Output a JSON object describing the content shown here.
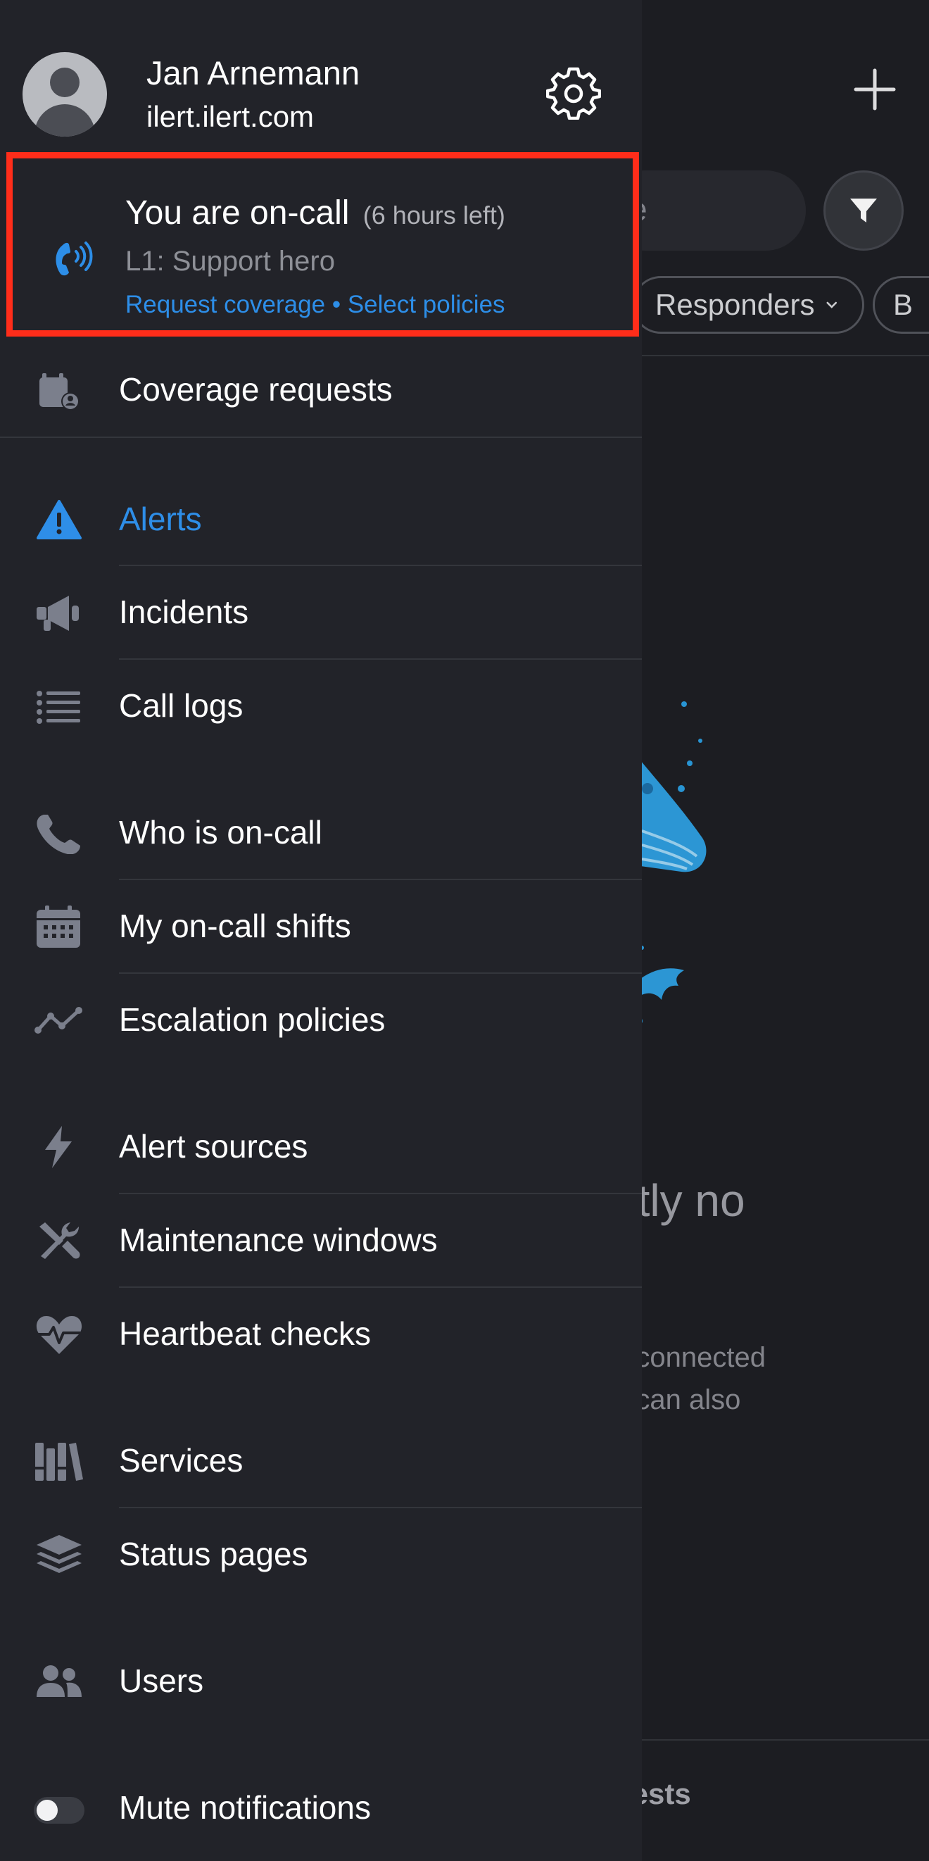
{
  "background": {
    "search_visible_text": "e",
    "chips": [
      "Responders",
      "B"
    ],
    "empty_title_fragment": "ntly no",
    "empty_text_fragment_1": "e connected",
    "empty_text_fragment_2": "n can also",
    "bottom_fragment": "uests"
  },
  "drawer": {
    "user": {
      "name": "Jan Arnemann",
      "domain": "ilert.ilert.com"
    },
    "oncall": {
      "title": "You are on-call",
      "time_left": "(6 hours left)",
      "role": "L1: Support hero",
      "link_request": "Request coverage",
      "separator": "•",
      "link_policies": "Select policies"
    },
    "items": [
      {
        "label": "Coverage requests",
        "icon": "calendar-user-icon"
      },
      {
        "label": "Alerts",
        "icon": "warning-triangle-icon",
        "active": true
      },
      {
        "label": "Incidents",
        "icon": "megaphone-icon"
      },
      {
        "label": "Call logs",
        "icon": "list-icon"
      },
      {
        "label": "Who is on-call",
        "icon": "phone-icon"
      },
      {
        "label": "My on-call shifts",
        "icon": "calendar-icon"
      },
      {
        "label": "Escalation policies",
        "icon": "chart-line-icon"
      },
      {
        "label": "Alert sources",
        "icon": "bolt-icon"
      },
      {
        "label": "Maintenance windows",
        "icon": "tools-icon"
      },
      {
        "label": "Heartbeat checks",
        "icon": "heart-pulse-icon"
      },
      {
        "label": "Services",
        "icon": "books-icon"
      },
      {
        "label": "Status pages",
        "icon": "layers-icon"
      },
      {
        "label": "Users",
        "icon": "users-icon"
      },
      {
        "label": "Mute notifications",
        "icon": "toggle-icon",
        "toggle_on": false
      }
    ]
  },
  "colors": {
    "drawer_bg": "#222329",
    "accent_blue": "#2e8ee8",
    "highlight_red": "#ff2d1a",
    "icon_gray": "#7b7f8c"
  }
}
